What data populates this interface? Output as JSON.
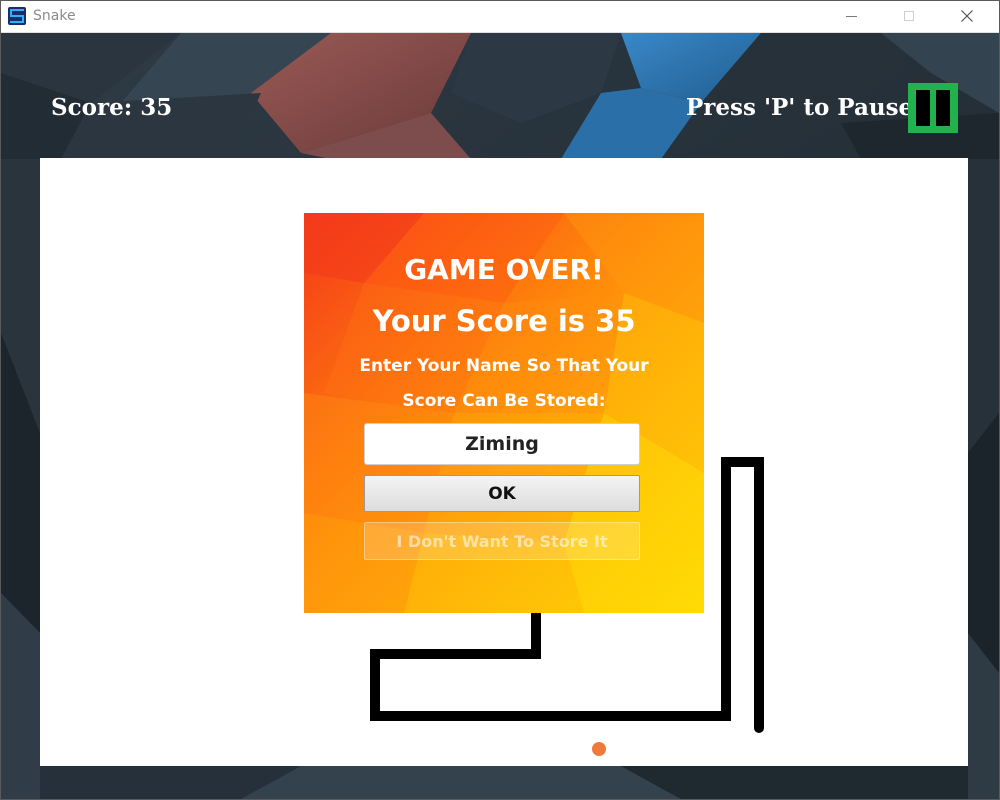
{
  "window": {
    "title": "Snake",
    "app_icon": "snake-app-icon",
    "controls": [
      "minimize-icon",
      "maximize-icon",
      "close-icon"
    ]
  },
  "hud": {
    "score": "Score: 35",
    "pause_hint": "Press 'P' to Pause",
    "pause_button_icon": "pause-icon"
  },
  "dialog": {
    "title": "GAME OVER!",
    "score_message": "Your Score is 35",
    "prompt_line1": "Enter Your Name So That Your",
    "prompt_line2": "Score Can Be Stored:",
    "name_value": "Ziming",
    "ok_label": "OK",
    "skip_label": "I Don't Want To Store It"
  },
  "colors": {
    "board": "#ffffff",
    "snake": "#000000",
    "food": "#f07a3a",
    "pause_button": "#22b14c",
    "dialog_gradient_start": "#f5381a",
    "dialog_gradient_end": "#ffe000"
  }
}
